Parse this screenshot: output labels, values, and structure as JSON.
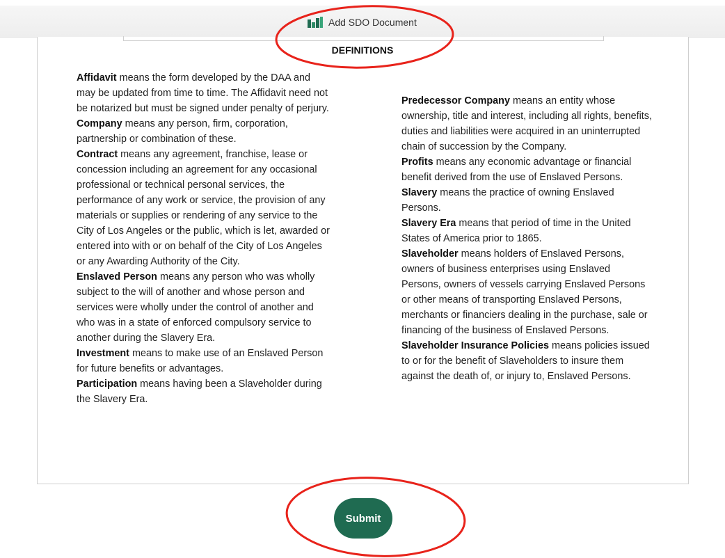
{
  "window": {
    "title": "Add SDO Document",
    "logo_icon": "bar-chart-logo-icon",
    "logo_color": "#1f6b51"
  },
  "section": {
    "heading": "DEFINITIONS"
  },
  "definitions_left": [
    {
      "term": "Affidavit",
      "text": " means the form developed by the DAA and may be updated from time to time. The Affidavit need not be notarized but must be signed under penalty of perjury."
    },
    {
      "term": "Company",
      "text": " means any person, firm, corporation, partnership or combination of these."
    },
    {
      "term": "Contract",
      "text": " means any agreement, franchise, lease or concession including an agreement for any occasional professional or technical personal services, the performance of any work or service, the provision of any materials or supplies or rendering of any service to the City of Los Angeles or the public, which is let, awarded or entered into with or on behalf of the City of Los Angeles or any Awarding Authority of the City."
    },
    {
      "term": "Enslaved Person",
      "text": " means any person who was wholly subject to the will of another and whose person and services were wholly under the control of another and who was in a state of enforced compulsory service to another during the Slavery Era."
    },
    {
      "term": "Investment",
      "text": " means to make use of an Enslaved Person for future benefits or advantages."
    },
    {
      "term": "Participation",
      "text": " means having been a Slaveholder during the Slavery Era."
    }
  ],
  "definitions_right": [
    {
      "term": "Predecessor Company",
      "text": " means an entity whose ownership, title and interest, including all rights, benefits, duties and liabilities were acquired in an uninterrupted chain of succession by the Company."
    },
    {
      "term": "Profits",
      "text": " means any economic advantage or financial benefit derived from the use of Enslaved Persons."
    },
    {
      "term": "Slavery",
      "text": " means the practice of owning Enslaved Persons."
    },
    {
      "term": "Slavery Era",
      "text": " means that period of time in the United States of America prior to 1865."
    },
    {
      "term": "Slaveholder",
      "text": " means holders of Enslaved Persons, owners of business enterprises using Enslaved Persons, owners of vessels carrying Enslaved Persons or other means of transporting Enslaved Persons, merchants or financiers dealing in the purchase, sale or financing of the business of Enslaved Persons."
    },
    {
      "term": "Slaveholder Insurance Policies",
      "text": " means policies issued to or for the benefit of Slaveholders to insure them against the death of, or injury to, Enslaved Persons."
    }
  ],
  "actions": {
    "submit_label": "Submit",
    "submit_color": "#1f6b51"
  },
  "annotations": {
    "highlight_color": "#e8231b"
  }
}
